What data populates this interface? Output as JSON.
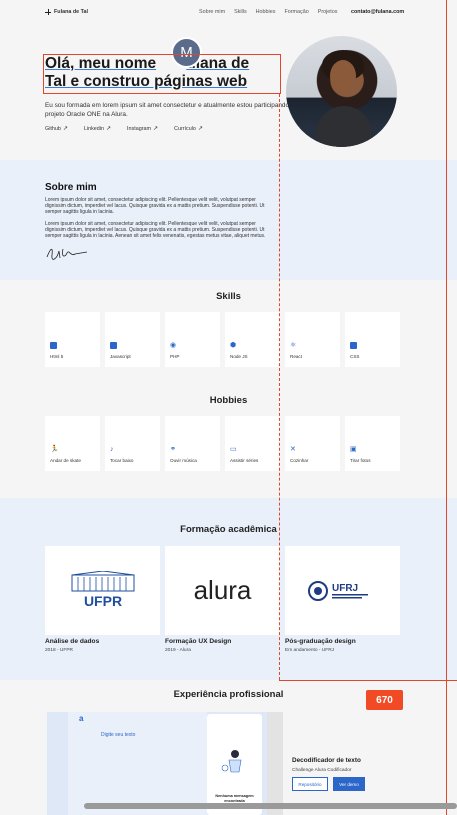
{
  "header": {
    "logo": "Fulana de Tal",
    "nav": [
      "Sobre mim",
      "Skills",
      "Hobbies",
      "Formação",
      "Projetos"
    ],
    "email": "contato@fulana.com"
  },
  "hero": {
    "title_part1": "Olá, meu nome",
    "title_part2": "ulana de",
    "title_line2": "Tal e construo páginas web",
    "description": "Eu sou formada em lorem ipsum sit amet consectetur e atualmente estou participando no projeto Oracle ONE na Alura.",
    "links": [
      "Github",
      "Linkedin",
      "Instagram",
      "Currículo"
    ],
    "avatar_letter": "M"
  },
  "sobre": {
    "title": "Sobre mim",
    "p1": "Lorem ipsum dolor sit amet, consectetur adipiscing elit. Pellentesque velit velit, volutpat semper dignissim dictum, imperdiet vel lacus. Quisque gravida ex a mattis pretium. Suspendisse potenti. Ut semper sagittis ligula in lacinia.",
    "p2": "Lorem ipsum dolor sit amet, consectetur adipiscing elit. Pellentesque velit velit, volutpat semper dignissim dictum, imperdiet vel lacus. Quisque gravida ex a mattis pretium. Suspendisse potenti. Ut semper sagittis ligula in lacinia. Aenean sit amet felis venenatis, egestas metus vitae, aliquet metus."
  },
  "skills": {
    "title": "Skills",
    "items": [
      "Html 5",
      "Javascript",
      "PHP",
      "Node JS",
      "React",
      "CSS"
    ]
  },
  "hobbies": {
    "title": "Hobbies",
    "items": [
      "Andar de skate",
      "Tocar baixo",
      "Ouvir música",
      "Assistir séries",
      "Cozinhar",
      "Tirar fotos"
    ]
  },
  "formacao": {
    "title": "Formação acadêmica",
    "items": [
      {
        "name": "Análise de dados",
        "sub": "2018 - UFPR",
        "logo": "UFPR"
      },
      {
        "name": "Formação UX Design",
        "sub": "2019 - Alura",
        "logo": "alura"
      },
      {
        "name": "Pós-graduação design",
        "sub": "Em andamento - UFRJ",
        "logo": "UFRJ"
      }
    ]
  },
  "experiencia": {
    "title": "Experiência profissional",
    "project_title": "Decodificador de texto",
    "project_sub": "Challenge Alura Codificador",
    "btn_repo": "Repositório",
    "btn_demo": "Ver demo",
    "mock_input": "Digite seu texto",
    "mock_msg": "Nenhuma mensagem encontrada"
  },
  "overlay": {
    "badge": "670"
  },
  "colors": {
    "accent": "#2b66c8",
    "section_bg": "#e9f0fa",
    "guide": "#e0472b"
  }
}
